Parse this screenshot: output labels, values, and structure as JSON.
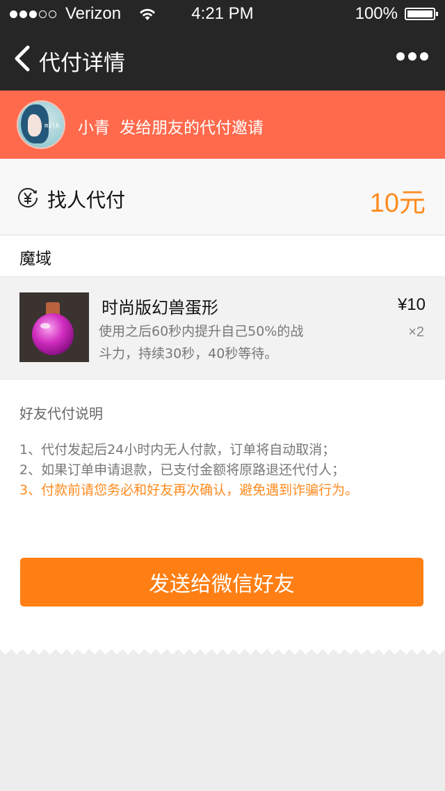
{
  "status_bar": {
    "carrier": "Verizon",
    "time": "4:21 PM",
    "battery": "100%"
  },
  "nav": {
    "title": "代付详情",
    "back_icon": "chevron-left-icon",
    "more_icon": "more-dots-icon"
  },
  "banner": {
    "name": "小青",
    "message": "发给朋友的代付邀请",
    "avatar_text": "milk",
    "color": "#ff6a4d"
  },
  "pay": {
    "label": "找人代付",
    "amount": "10元",
    "icon": "yen-circle-icon",
    "amount_color": "#ff8a1e"
  },
  "game": {
    "label": "魔域"
  },
  "item": {
    "title": "时尚版幻兽蛋形",
    "desc_line1": "使用之后60秒内提升自己50%的战",
    "desc_line2": "斗力，持续30秒，40秒等待。",
    "price": "¥10",
    "qty": "×2"
  },
  "notes": {
    "title": "好友代付说明",
    "items": [
      "1、代付发起后24小时内无人付款，订单将自动取消；",
      "2、如果订单申请退款，已支付金额将原路退还代付人；",
      "3、付款前请您务必和好友再次确认，避免遇到诈骗行为。"
    ],
    "warn_color": "#ff8a1e"
  },
  "send_button": {
    "label": "发送给微信好友",
    "color": "#ff7f14"
  }
}
